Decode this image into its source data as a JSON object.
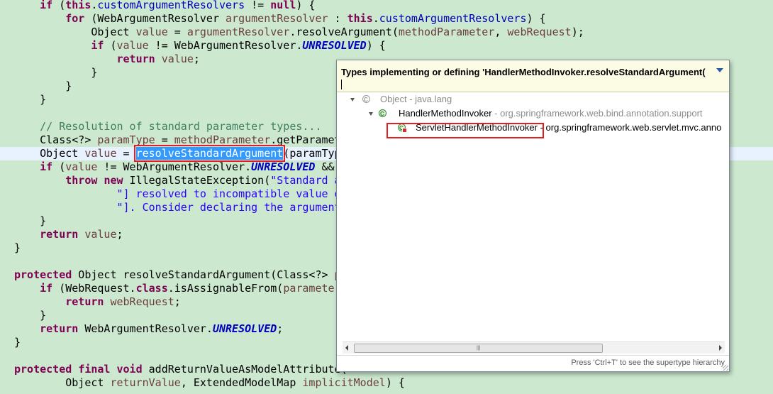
{
  "code": {
    "lines": [
      {
        "segs": [
          {
            "t": "    "
          },
          {
            "t": "if",
            "c": "kw"
          },
          {
            "t": " ("
          },
          {
            "t": "this",
            "c": "kw"
          },
          {
            "t": "."
          },
          {
            "t": "customArgumentResolvers",
            "c": "fld"
          },
          {
            "t": " != "
          },
          {
            "t": "null",
            "c": "kw"
          },
          {
            "t": ") {"
          }
        ]
      },
      {
        "segs": [
          {
            "t": "        "
          },
          {
            "t": "for",
            "c": "kw"
          },
          {
            "t": " (WebArgumentResolver "
          },
          {
            "t": "argumentResolver",
            "c": "var"
          },
          {
            "t": " : "
          },
          {
            "t": "this",
            "c": "kw"
          },
          {
            "t": "."
          },
          {
            "t": "customArgumentResolvers",
            "c": "fld"
          },
          {
            "t": ") {"
          }
        ]
      },
      {
        "segs": [
          {
            "t": "            Object "
          },
          {
            "t": "value",
            "c": "var"
          },
          {
            "t": " = "
          },
          {
            "t": "argumentResolver",
            "c": "var"
          },
          {
            "t": ".resolveArgument("
          },
          {
            "t": "methodParameter",
            "c": "var"
          },
          {
            "t": ", "
          },
          {
            "t": "webRequest",
            "c": "var"
          },
          {
            "t": ");"
          }
        ]
      },
      {
        "segs": [
          {
            "t": "            "
          },
          {
            "t": "if",
            "c": "kw"
          },
          {
            "t": " ("
          },
          {
            "t": "value",
            "c": "var"
          },
          {
            "t": " != WebArgumentResolver."
          },
          {
            "t": "UNRESOLVED",
            "c": "const"
          },
          {
            "t": ") {"
          }
        ]
      },
      {
        "segs": [
          {
            "t": "                "
          },
          {
            "t": "return",
            "c": "kw"
          },
          {
            "t": " "
          },
          {
            "t": "value",
            "c": "var"
          },
          {
            "t": ";"
          }
        ]
      },
      {
        "segs": [
          {
            "t": "            }"
          }
        ]
      },
      {
        "segs": [
          {
            "t": "        }"
          }
        ]
      },
      {
        "segs": [
          {
            "t": "    }"
          }
        ]
      },
      {
        "segs": [
          {
            "t": ""
          }
        ]
      },
      {
        "segs": [
          {
            "t": "    "
          },
          {
            "t": "// Resolution of standard parameter types...",
            "c": "cmt"
          }
        ]
      },
      {
        "segs": [
          {
            "t": "    Class<?> "
          },
          {
            "t": "paramType",
            "c": "var"
          },
          {
            "t": " = "
          },
          {
            "t": "methodParameter",
            "c": "var"
          },
          {
            "t": ".getParamet"
          }
        ]
      },
      {
        "current": true,
        "segs": [
          {
            "t": "    Object "
          },
          {
            "t": "value",
            "c": "var"
          },
          {
            "t": " = "
          },
          {
            "t": "resolveStandardArgument",
            "c": "sel"
          },
          {
            "t": "(paramTyp"
          }
        ]
      },
      {
        "segs": [
          {
            "t": "    "
          },
          {
            "t": "if",
            "c": "kw"
          },
          {
            "t": " ("
          },
          {
            "t": "value",
            "c": "var"
          },
          {
            "t": " != WebArgumentResolver."
          },
          {
            "t": "UNRESOLVED",
            "c": "const"
          },
          {
            "t": " &&"
          }
        ]
      },
      {
        "segs": [
          {
            "t": "        "
          },
          {
            "t": "throw",
            "c": "kw"
          },
          {
            "t": " "
          },
          {
            "t": "new",
            "c": "kw"
          },
          {
            "t": " IllegalStateException("
          },
          {
            "t": "\"Standard a",
            "c": "str"
          }
        ]
      },
      {
        "segs": [
          {
            "t": "                "
          },
          {
            "t": "\"] resolved to incompatible value o",
            "c": "str"
          }
        ]
      },
      {
        "segs": [
          {
            "t": "                "
          },
          {
            "t": "\"]. Consider declaring the argument",
            "c": "str"
          }
        ]
      },
      {
        "segs": [
          {
            "t": "    }"
          }
        ]
      },
      {
        "segs": [
          {
            "t": "    "
          },
          {
            "t": "return",
            "c": "kw"
          },
          {
            "t": " "
          },
          {
            "t": "value",
            "c": "var"
          },
          {
            "t": ";"
          }
        ]
      },
      {
        "segs": [
          {
            "t": "}"
          }
        ]
      },
      {
        "segs": [
          {
            "t": ""
          }
        ]
      },
      {
        "segs": [
          {
            "t": "protected",
            "c": "kw"
          },
          {
            "t": " Object resolveStandardArgument(Class<?> "
          },
          {
            "t": "p",
            "c": "var"
          }
        ]
      },
      {
        "segs": [
          {
            "t": "    "
          },
          {
            "t": "if",
            "c": "kw"
          },
          {
            "t": " (WebRequest."
          },
          {
            "t": "class",
            "c": "kw"
          },
          {
            "t": ".isAssignableFrom("
          },
          {
            "t": "parameter",
            "c": "var"
          }
        ]
      },
      {
        "segs": [
          {
            "t": "        "
          },
          {
            "t": "return",
            "c": "kw"
          },
          {
            "t": " "
          },
          {
            "t": "webRequest",
            "c": "var"
          },
          {
            "t": ";"
          }
        ]
      },
      {
        "segs": [
          {
            "t": "    }"
          }
        ]
      },
      {
        "segs": [
          {
            "t": "    "
          },
          {
            "t": "return",
            "c": "kw"
          },
          {
            "t": " WebArgumentResolver."
          },
          {
            "t": "UNRESOLVED",
            "c": "const"
          },
          {
            "t": ";"
          }
        ]
      },
      {
        "segs": [
          {
            "t": "}"
          }
        ]
      },
      {
        "segs": [
          {
            "t": ""
          }
        ]
      },
      {
        "segs": [
          {
            "t": "protected",
            "c": "kw"
          },
          {
            "t": " "
          },
          {
            "t": "final",
            "c": "kw"
          },
          {
            "t": " "
          },
          {
            "t": "void",
            "c": "kw"
          },
          {
            "t": " addReturnValueAsModelAttribute("
          }
        ]
      },
      {
        "segs": [
          {
            "t": "        Object "
          },
          {
            "t": "returnValue",
            "c": "var"
          },
          {
            "t": ", ExtendedModelMap "
          },
          {
            "t": "implicitModel",
            "c": "var"
          },
          {
            "t": ") {"
          }
        ]
      }
    ]
  },
  "popup": {
    "title": "Types implementing or defining 'HandlerMethodInvoker.resolveStandardArgument(",
    "filter_value": "",
    "tree": [
      {
        "label": "Object",
        "qualifier": " - java.lang",
        "icon": "class-icon"
      },
      {
        "label": "HandlerMethodInvoker",
        "qualifier": " - org.springframework.web.bind.annotation.support",
        "icon": "class-icon"
      },
      {
        "label": "ServletHandlerMethodInvoker",
        "qualifier": " - org.springframework.web.servlet.mvc.anno",
        "icon": "class-icon"
      }
    ],
    "status": "Press 'Ctrl+T' to see the supertype hierarchy"
  }
}
